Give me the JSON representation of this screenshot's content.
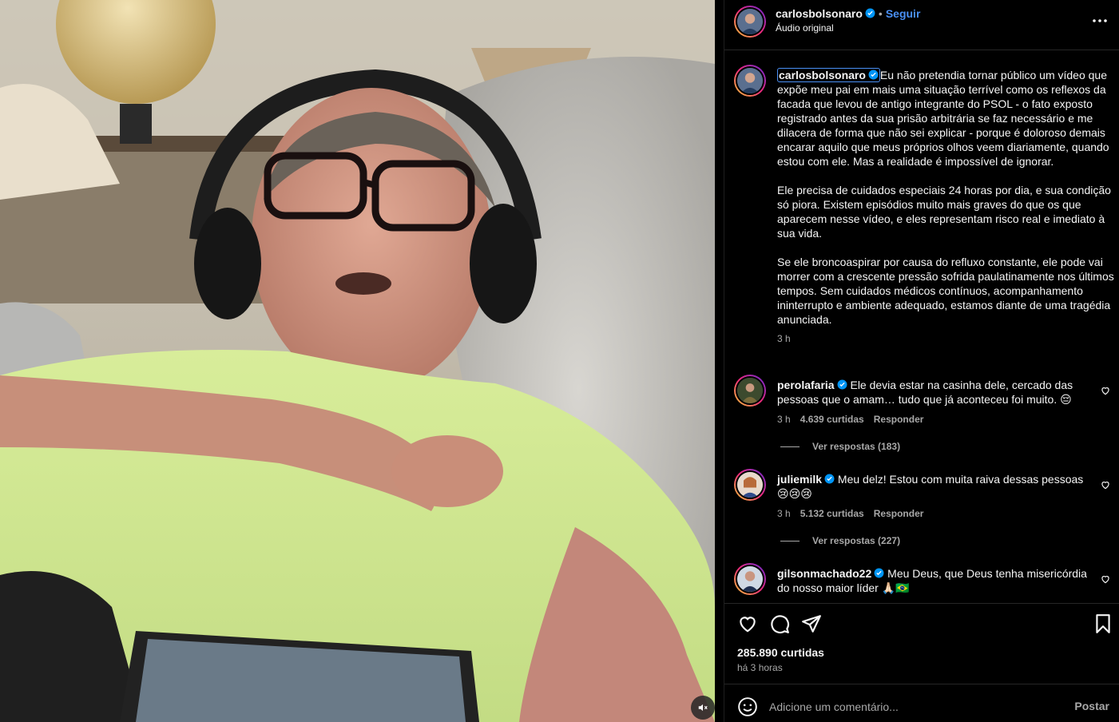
{
  "post": {
    "author": "carlosbolsonaro",
    "follow_label": "Seguir",
    "separator": "•",
    "audio": "Áudio original",
    "more_icon": "more-horizontal-icon"
  },
  "caption": {
    "author": "carlosbolsonaro",
    "paragraph1": "Eu não pretendia tornar público um vídeo que expõe meu pai em mais uma situação terrível como os reflexos da facada que levou de antigo integrante do PSOL - o fato exposto registrado antes da sua prisão arbitrária se faz necessário e me dilacera de forma que não sei explicar - porque é doloroso demais encarar aquilo que meus próprios olhos veem diariamente, quando estou com ele. Mas a realidade é impossível de ignorar.",
    "paragraph2": "Ele precisa de cuidados especiais 24 horas por dia, e sua condição só piora. Existem episódios muito mais graves do que os que aparecem nesse vídeo, e eles representam risco real e imediato à sua vida.",
    "paragraph3": "Se ele broncoaspirar por causa do refluxo constante, ele pode vai morrer com a crescente pressão sofrida paulatinamente nos últimos tempos. Sem cuidados médicos contínuos, acompanhamento ininterrupto e ambiente adequado, estamos diante de uma tragédia anunciada.",
    "time": "3 h"
  },
  "comments": [
    {
      "user": "perolafaria",
      "text": "Ele devia estar na casinha dele, cercado das pessoas que o amam… tudo que já aconteceu foi muito. 😔",
      "time": "3 h",
      "likes": "4.639 curtidas",
      "reply": "Responder",
      "view_replies": "Ver respostas (183)"
    },
    {
      "user": "juliemilk",
      "text": "Meu delz! Estou com muita raiva dessas pessoas 😢😢😢",
      "time": "3 h",
      "likes": "5.132 curtidas",
      "reply": "Responder",
      "view_replies": "Ver respostas (227)"
    },
    {
      "user": "gilsonmachado22",
      "text": "Meu Deus, que Deus tenha misericórdia do nosso maior líder 🙏🏻🇧🇷"
    }
  ],
  "footer": {
    "likes": "285.890 curtidas",
    "ago": "há 3 horas",
    "comment_placeholder": "Adicione um comentário...",
    "post_label": "Postar"
  },
  "colors": {
    "link_blue": "#4a90f5",
    "muted": "#a8a8a8",
    "background": "#000000"
  }
}
